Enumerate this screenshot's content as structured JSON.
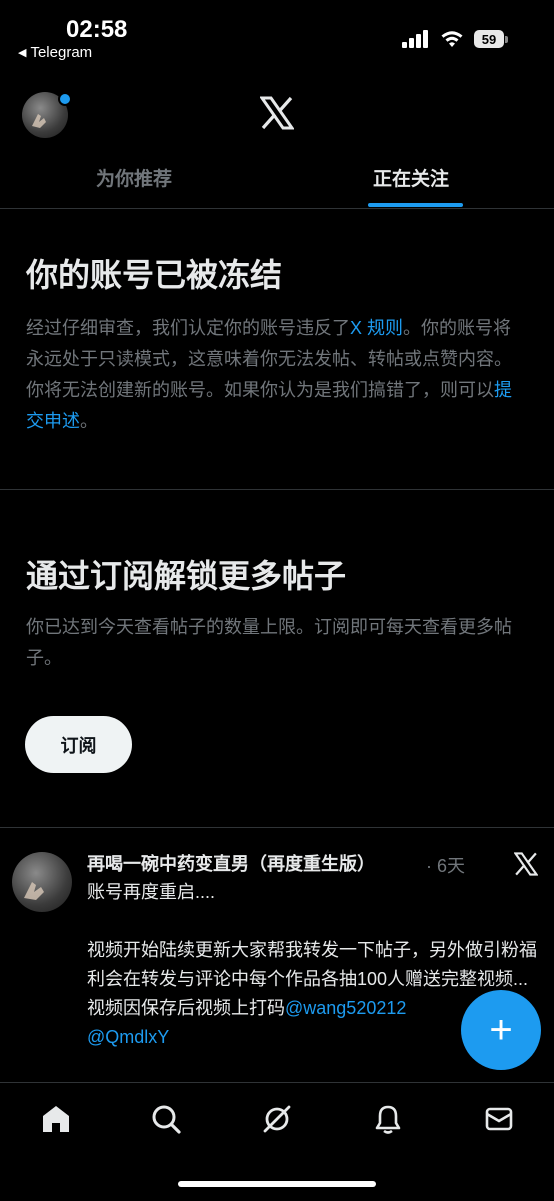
{
  "status_bar": {
    "time": "02:58",
    "back_app": "Telegram",
    "battery": "59"
  },
  "header": {
    "logo": "X",
    "tabs": [
      {
        "label": "为你推荐",
        "active": false
      },
      {
        "label": "正在关注",
        "active": true
      }
    ]
  },
  "frozen": {
    "title": "你的账号已被冻结",
    "text_1": "经过仔细审查，我们认定你的账号违反了",
    "link_rules": "X 规则",
    "text_2": "。你的账号将永远处于只读模式，这意味着你无法发帖、转帖或点赞内容。你将无法创建新的账号。如果你认为是我们搞错了，则可以",
    "link_appeal": "提交申述",
    "text_3": "。"
  },
  "subscribe": {
    "title": "通过订阅解锁更多帖子",
    "text": "你已达到今天查看帖子的数量上限。订阅即可每天查看更多帖子。",
    "button": "订阅"
  },
  "tweet": {
    "author": "再喝一碗中药变直男（再度重生版）",
    "time": "· 6天",
    "line1": "账号再度重启....",
    "line2": "视频开始陆续更新大家帮我转发一下帖子，另外做引粉福利会在转发与评论中每个作品各抽100人赠送完整视频...",
    "line3_prefix": "视频因保存后视频上打码",
    "mention1": "@wang520212",
    "mention2": "@QmdlxY"
  },
  "fab": {
    "label": "+"
  },
  "nav": [
    "home-icon",
    "search-icon",
    "grok-icon",
    "notifications-icon",
    "messages-icon"
  ],
  "colors": {
    "accent": "#1d9bf0",
    "background": "#000000",
    "muted": "#71767b"
  }
}
